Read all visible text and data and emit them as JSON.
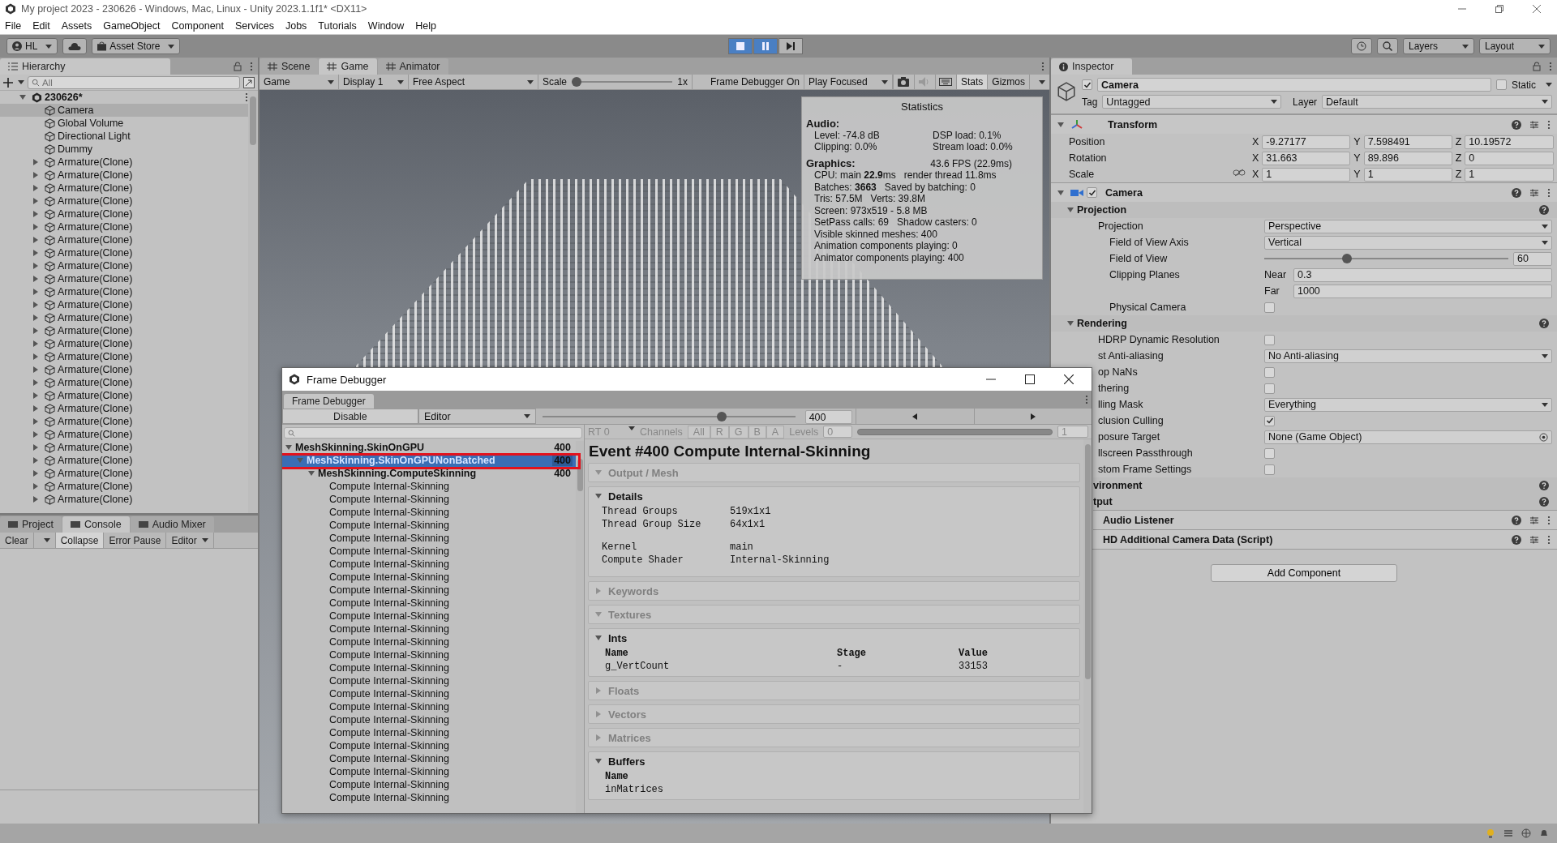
{
  "window": {
    "title": "My project 2023 - 230626 - Windows, Mac, Linux - Unity 2023.1.1f1* <DX11>"
  },
  "menu": [
    "File",
    "Edit",
    "Assets",
    "GameObject",
    "Component",
    "Services",
    "Jobs",
    "Tutorials",
    "Window",
    "Help"
  ],
  "toolbar": {
    "account": "HL",
    "store": "Asset Store",
    "playing": true,
    "paused": true,
    "layers": "Layers",
    "layout": "Layout"
  },
  "hierarchy": {
    "tabs": [
      {
        "label": "Hierarchy",
        "selected": true
      }
    ],
    "placeholder": "All",
    "scene": {
      "name": "230626*",
      "expanded": true,
      "children": [
        {
          "name": "Camera",
          "kind": "object",
          "selected": true
        },
        {
          "name": "Global Volume",
          "kind": "object",
          "selected": false
        },
        {
          "name": "Directional Light",
          "kind": "object",
          "selected": false
        },
        {
          "name": "Dummy",
          "kind": "object",
          "selected": false
        },
        {
          "name": "Armature(Clone)",
          "kind": "group",
          "selected": false
        },
        {
          "name": "Armature(Clone)",
          "kind": "group",
          "selected": false
        },
        {
          "name": "Armature(Clone)",
          "kind": "group",
          "selected": false
        },
        {
          "name": "Armature(Clone)",
          "kind": "group",
          "selected": false
        },
        {
          "name": "Armature(Clone)",
          "kind": "group",
          "selected": false
        },
        {
          "name": "Armature(Clone)",
          "kind": "group",
          "selected": false
        },
        {
          "name": "Armature(Clone)",
          "kind": "group",
          "selected": false
        },
        {
          "name": "Armature(Clone)",
          "kind": "group",
          "selected": false
        },
        {
          "name": "Armature(Clone)",
          "kind": "group",
          "selected": false
        },
        {
          "name": "Armature(Clone)",
          "kind": "group",
          "selected": false
        },
        {
          "name": "Armature(Clone)",
          "kind": "group",
          "selected": false
        },
        {
          "name": "Armature(Clone)",
          "kind": "group",
          "selected": false
        },
        {
          "name": "Armature(Clone)",
          "kind": "group",
          "selected": false
        },
        {
          "name": "Armature(Clone)",
          "kind": "group",
          "selected": false
        },
        {
          "name": "Armature(Clone)",
          "kind": "group",
          "selected": false
        },
        {
          "name": "Armature(Clone)",
          "kind": "group",
          "selected": false
        },
        {
          "name": "Armature(Clone)",
          "kind": "group",
          "selected": false
        },
        {
          "name": "Armature(Clone)",
          "kind": "group",
          "selected": false
        },
        {
          "name": "Armature(Clone)",
          "kind": "group",
          "selected": false
        },
        {
          "name": "Armature(Clone)",
          "kind": "group",
          "selected": false
        },
        {
          "name": "Armature(Clone)",
          "kind": "group",
          "selected": false
        },
        {
          "name": "Armature(Clone)",
          "kind": "group",
          "selected": false
        },
        {
          "name": "Armature(Clone)",
          "kind": "group",
          "selected": false
        },
        {
          "name": "Armature(Clone)",
          "kind": "group",
          "selected": false
        },
        {
          "name": "Armature(Clone)",
          "kind": "group",
          "selected": false
        },
        {
          "name": "Armature(Clone)",
          "kind": "group",
          "selected": false
        },
        {
          "name": "Armature(Clone)",
          "kind": "group",
          "selected": false
        }
      ]
    }
  },
  "view_tabs": [
    {
      "label": "Scene",
      "selected": false
    },
    {
      "label": "Game",
      "selected": true
    },
    {
      "label": "Animator",
      "selected": false
    }
  ],
  "game_toolbar": {
    "view": "Game",
    "display": "Display 1",
    "aspect": "Free Aspect",
    "scale_label": "Scale",
    "scale_slider": {
      "level": 0
    },
    "scale_value": "1x",
    "frame_debugger": "Frame Debugger On",
    "play_mode": "Play Focused",
    "stats": {
      "label": "Stats",
      "on": true
    },
    "gizmos": "Gizmos"
  },
  "statistics": {
    "title": "Statistics",
    "audio_heading": "Audio:",
    "audio": [
      [
        "Level: -74.8 dB",
        "DSP load: 0.1%"
      ],
      [
        "Clipping: 0.0%",
        "Stream load: 0.0%"
      ]
    ],
    "graphics_heading": "Graphics:",
    "fps": "43.6 FPS (22.9ms)",
    "graphics": [
      [
        "CPU: main **22.9**ms",
        "render thread 11.8ms"
      ],
      [
        "Batches: **3663**",
        "Saved by batching: 0"
      ],
      [
        "Tris: 57.5M",
        "Verts: 39.8M"
      ],
      [
        "Screen: 973x519 - 5.8 MB"
      ],
      [
        "SetPass calls: 69",
        "Shadow casters: 0"
      ],
      [
        "Visible skinned meshes: 400"
      ],
      [
        "Animation components playing: 0"
      ],
      [
        "Animator components playing: 400"
      ]
    ]
  },
  "bottom_tabs": [
    {
      "label": "Project",
      "selected": false
    },
    {
      "label": "Console",
      "selected": true
    },
    {
      "label": "Audio Mixer",
      "selected": false
    }
  ],
  "console_toolbar": {
    "clear": "Clear",
    "toggles": [
      {
        "label": "Collapse",
        "on": true
      },
      {
        "label": "Error Pause",
        "on": false
      }
    ],
    "editor": "Editor"
  },
  "inspector": {
    "tabs": [
      {
        "label": "Inspector",
        "selected": true
      }
    ],
    "object": {
      "active": true,
      "name": "Camera",
      "static": false,
      "static_label": "Static",
      "tag_label": "Tag",
      "tag": "Untagged",
      "layer_label": "Layer",
      "layer": "Default"
    },
    "components": [
      {
        "kind": "transform",
        "title": "Transform",
        "expanded": true,
        "rows": [
          {
            "label": "Position",
            "fields": [
              {
                "axis": "X",
                "value": "-9.27177"
              },
              {
                "axis": "Y",
                "value": "7.598491"
              },
              {
                "axis": "Z",
                "value": "10.19572"
              }
            ]
          },
          {
            "label": "Rotation",
            "fields": [
              {
                "axis": "X",
                "value": "31.663"
              },
              {
                "axis": "Y",
                "value": "89.896"
              },
              {
                "axis": "Z",
                "value": "0"
              }
            ]
          },
          {
            "label": "Scale",
            "linked": false,
            "fields": [
              {
                "axis": "X",
                "value": "1"
              },
              {
                "axis": "Y",
                "value": "1"
              },
              {
                "axis": "Z",
                "value": "1"
              }
            ]
          }
        ]
      },
      {
        "kind": "camera",
        "title": "Camera",
        "enabled": true,
        "expanded": true,
        "sections": [
          {
            "title": "Projection",
            "expanded": true,
            "rows": [
              {
                "kind": "dropdown",
                "label": "Projection",
                "value": "Perspective",
                "children": [
                  {
                    "kind": "dropdown",
                    "label": "Field of View Axis",
                    "value": "Vertical"
                  },
                  {
                    "kind": "slider",
                    "label": "Field of View",
                    "level": 0.34,
                    "value": "60"
                  },
                  {
                    "kind": "pair",
                    "label": "Clipping Planes",
                    "field_label": "Near",
                    "value": "0.3"
                  },
                  {
                    "kind": "pair",
                    "field_label": "Far",
                    "value": "1000"
                  },
                  {
                    "kind": "checkbox",
                    "label": "Physical Camera",
                    "checked": false
                  }
                ]
              }
            ]
          },
          {
            "title": "Rendering",
            "expanded": true,
            "rows": [
              {
                "kind": "checkbox",
                "label": "HDRP Dynamic Resolution",
                "checked": false
              },
              {
                "kind": "dropdown",
                "label": "st Anti-aliasing",
                "value": "No Anti-aliasing"
              },
              {
                "kind": "checkbox",
                "label": "op NaNs",
                "checked": false
              },
              {
                "kind": "checkbox",
                "label": "thering",
                "checked": false
              },
              {
                "kind": "dropdown",
                "label": "lling Mask",
                "value": "Everything"
              },
              {
                "kind": "checkbox",
                "label": "clusion Culling",
                "checked": true
              },
              {
                "kind": "object",
                "label": "posure Target",
                "value": "None (Game Object)"
              },
              {
                "kind": "checkbox",
                "label": "llscreen Passthrough",
                "checked": false
              },
              {
                "kind": "checkbox",
                "label": "stom Frame Settings",
                "checked": false
              }
            ]
          },
          {
            "title": "vironment"
          },
          {
            "title": "tput"
          }
        ]
      },
      {
        "kind": "component",
        "title": "Audio Listener"
      },
      {
        "kind": "component",
        "title": "HD Additional Camera Data (Script)"
      }
    ],
    "add_component": "Add Component"
  },
  "frame_debugger": {
    "title": "Frame Debugger",
    "tab": "Frame Debugger",
    "disable": "Disable",
    "target": "Editor",
    "event_slider": {
      "level": 0.71
    },
    "event": "400",
    "tree": [
      {
        "name": "MeshSkinning.SkinOnGPU",
        "count": "400",
        "expanded": true,
        "selected": false,
        "children": [
          {
            "name": "MeshSkinning.SkinOnGPUNonBatched",
            "count": "400",
            "expanded": true,
            "selected": true,
            "highlighted": true,
            "children": [
              {
                "name": "MeshSkinning.ComputeSkinning",
                "count": "400",
                "expanded": true,
                "selected": false,
                "children": [
                  {
                    "name": "Compute Internal-Skinning",
                    "selected": false
                  },
                  {
                    "name": "Compute Internal-Skinning",
                    "selected": false
                  },
                  {
                    "name": "Compute Internal-Skinning",
                    "selected": false
                  },
                  {
                    "name": "Compute Internal-Skinning",
                    "selected": false
                  },
                  {
                    "name": "Compute Internal-Skinning",
                    "selected": false
                  },
                  {
                    "name": "Compute Internal-Skinning",
                    "selected": false
                  },
                  {
                    "name": "Compute Internal-Skinning",
                    "selected": false
                  },
                  {
                    "name": "Compute Internal-Skinning",
                    "selected": false
                  },
                  {
                    "name": "Compute Internal-Skinning",
                    "selected": false
                  },
                  {
                    "name": "Compute Internal-Skinning",
                    "selected": false
                  },
                  {
                    "name": "Compute Internal-Skinning",
                    "selected": false
                  },
                  {
                    "name": "Compute Internal-Skinning",
                    "selected": false
                  },
                  {
                    "name": "Compute Internal-Skinning",
                    "selected": false
                  },
                  {
                    "name": "Compute Internal-Skinning",
                    "selected": false
                  },
                  {
                    "name": "Compute Internal-Skinning",
                    "selected": false
                  },
                  {
                    "name": "Compute Internal-Skinning",
                    "selected": false
                  },
                  {
                    "name": "Compute Internal-Skinning",
                    "selected": false
                  },
                  {
                    "name": "Compute Internal-Skinning",
                    "selected": false
                  },
                  {
                    "name": "Compute Internal-Skinning",
                    "selected": false
                  },
                  {
                    "name": "Compute Internal-Skinning",
                    "selected": false
                  },
                  {
                    "name": "Compute Internal-Skinning",
                    "selected": false
                  },
                  {
                    "name": "Compute Internal-Skinning",
                    "selected": false
                  },
                  {
                    "name": "Compute Internal-Skinning",
                    "selected": false
                  },
                  {
                    "name": "Compute Internal-Skinning",
                    "selected": false
                  },
                  {
                    "name": "Compute Internal-Skinning",
                    "selected": false
                  }
                ]
              }
            ]
          }
        ]
      }
    ],
    "target_bar": {
      "disabled": true,
      "rt": "RT 0",
      "channels_label": "Channels",
      "channels": [
        "All",
        "R",
        "G",
        "B",
        "A"
      ],
      "levels_label": "Levels",
      "levels_min": "0",
      "levels_max": "1"
    },
    "event_title": "Event #400 Compute Internal-Skinning",
    "sections": [
      {
        "kind": "header",
        "title": "Output / Mesh",
        "expanded": true,
        "disabled": true
      },
      {
        "kind": "details",
        "title": "Details",
        "expanded": true,
        "disabled": false,
        "groups": [
          [
            [
              "Thread Groups",
              "519x1x1"
            ],
            [
              "Thread Group Size",
              "64x1x1"
            ]
          ],
          [
            [
              "Kernel",
              "main"
            ],
            [
              "Compute Shader",
              "Internal-Skinning"
            ]
          ]
        ]
      },
      {
        "kind": "header",
        "title": "Keywords",
        "expanded": false,
        "disabled": true
      },
      {
        "kind": "header",
        "title": "Textures",
        "expanded": true,
        "disabled": true
      },
      {
        "kind": "table",
        "title": "Ints",
        "expanded": true,
        "disabled": false,
        "columns": [
          "Name",
          "Stage",
          "Value"
        ],
        "rows": [
          [
            "g_VertCount",
            "-",
            "33153"
          ]
        ]
      },
      {
        "kind": "header",
        "title": "Floats",
        "expanded": false,
        "disabled": true
      },
      {
        "kind": "header",
        "title": "Vectors",
        "expanded": false,
        "disabled": true
      },
      {
        "kind": "header",
        "title": "Matrices",
        "expanded": false,
        "disabled": true
      },
      {
        "kind": "table",
        "title": "Buffers",
        "expanded": true,
        "disabled": false,
        "columns": [
          "Name"
        ],
        "rows": [
          [
            "inMatrices"
          ]
        ]
      }
    ]
  }
}
